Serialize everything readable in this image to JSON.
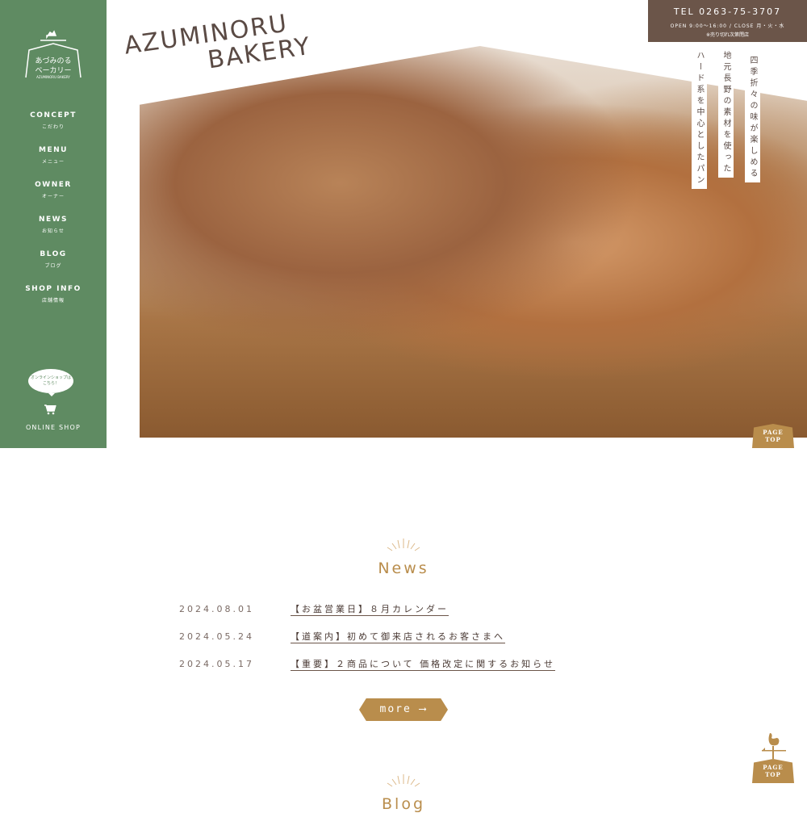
{
  "sidebar": {
    "logo": {
      "line1": "あづみのる",
      "line2": "ベーカリー",
      "sub": "AZUMINORU BAKERY"
    },
    "nav": [
      {
        "en": "CONCEPT",
        "jp": "こだわり"
      },
      {
        "en": "MENU",
        "jp": "メニュー"
      },
      {
        "en": "OWNER",
        "jp": "オーナー"
      },
      {
        "en": "NEWS",
        "jp": "お知らせ"
      },
      {
        "en": "BLOG",
        "jp": "ブログ"
      },
      {
        "en": "SHOP INFO",
        "jp": "店舗情報"
      }
    ],
    "online_bubble": "オンラインショップは こちら！",
    "online_label": "ONLINE SHOP"
  },
  "brand": {
    "line1": "AZUMINORU",
    "line2": "BAKERY"
  },
  "contact": {
    "tel": "TEL 0263-75-3707",
    "hours": "OPEN 9:00〜16:00 / CLOSE 月・火・水",
    "note": "※売り切れ次第閉店"
  },
  "hero_copy": [
    "四季折々の味が楽しめる",
    "地元長野の素材を使った",
    "ハード系を中心としたパン"
  ],
  "page_top": {
    "line1": "PAGE",
    "line2": "TOP"
  },
  "news": {
    "title": "News",
    "items": [
      {
        "date": "2024.08.01",
        "title": "【お盆営業日】８月カレンダー"
      },
      {
        "date": "2024.05.24",
        "title": "【道案内】初めて御来店されるお客さまへ"
      },
      {
        "date": "2024.05.17",
        "title": "【重要】２商品について 価格改定に関するお知らせ"
      }
    ],
    "more": "more"
  },
  "blog": {
    "title": "Blog"
  },
  "colors": {
    "sidebar": "#5f8b62",
    "accent": "#b98d4c",
    "tel_bg": "#6b5549"
  }
}
